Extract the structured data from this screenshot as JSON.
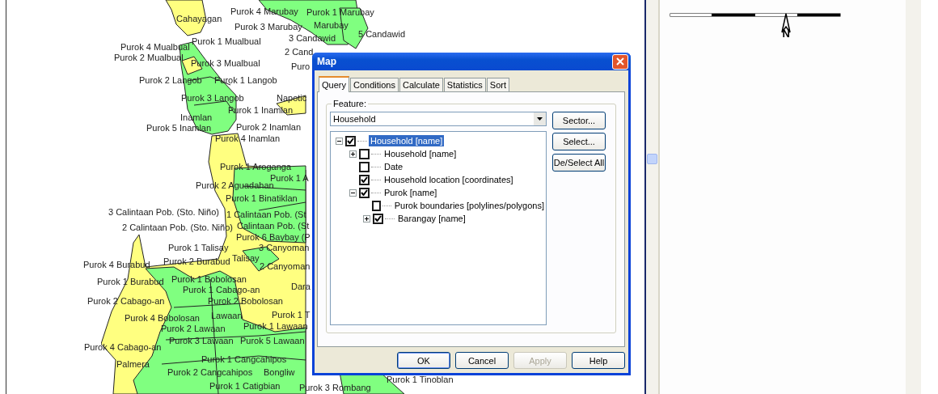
{
  "map": {
    "labels": [
      {
        "text": "Cahayagan"
      },
      {
        "text": "Purok 4 Marubay"
      },
      {
        "text": "Purok 1 Marubay"
      },
      {
        "text": "Purok 3 Marubay"
      },
      {
        "text": "Marubay"
      },
      {
        "text": "3 Candawid"
      },
      {
        "text": "5 Candawid"
      },
      {
        "text": "Purok 1 Mualbual"
      },
      {
        "text": "Purok 4 Mualbual"
      },
      {
        "text": "2 Cand"
      },
      {
        "text": "Purok 2 Mualbual"
      },
      {
        "text": "Puro"
      },
      {
        "text": "Purok 3 Mualbual"
      },
      {
        "text": "Purok 2 Langob"
      },
      {
        "text": "Purok 1 Langob"
      },
      {
        "text": "Purok 3 Langob"
      },
      {
        "text": "Napotic"
      },
      {
        "text": "Purok 1 Inamlan"
      },
      {
        "text": "Inamlan"
      },
      {
        "text": "Purok 5 Inamlan"
      },
      {
        "text": "Purok 2 Inamlan"
      },
      {
        "text": "Purok 4 Inamlan"
      },
      {
        "text": "Purok 1 Aroganga"
      },
      {
        "text": "Purok 1 A"
      },
      {
        "text": "Purok 2 Aguadahan"
      },
      {
        "text": "Purok 1 Binatiklan"
      },
      {
        "text": "3 Calintaan Pob. (Sto. Niño)"
      },
      {
        "text": "1 Calintaan Pob. (St"
      },
      {
        "text": "2 Calintaan Pob. (Sto. Niño)"
      },
      {
        "text": "Calintaan Pob. (St"
      },
      {
        "text": "Purok 6 Baybay (P"
      },
      {
        "text": "Purok 1 Talisay"
      },
      {
        "text": "3 Canyoman"
      },
      {
        "text": "Purok 4 Burabud"
      },
      {
        "text": "Purok 2 Burabud"
      },
      {
        "text": "Talisay"
      },
      {
        "text": "2 Canyoman"
      },
      {
        "text": "Purok 1 Burabud"
      },
      {
        "text": "Purok 1 Bobolosan"
      },
      {
        "text": "Dara"
      },
      {
        "text": "Purok 1 Cabago-an"
      },
      {
        "text": "Purok 2 Cabago-an"
      },
      {
        "text": "Purok 2 Bobolosan"
      },
      {
        "text": "Purok 4 Bobolosan"
      },
      {
        "text": "Lawaan"
      },
      {
        "text": "Purok 1 T"
      },
      {
        "text": "Purok 2 Lawaan"
      },
      {
        "text": "Purok 1 Lawaan"
      },
      {
        "text": "Purok 3 Lawaan"
      },
      {
        "text": "Purok 5 Lawaan"
      },
      {
        "text": "Purok 4 Cabago-an"
      },
      {
        "text": "Palmera"
      },
      {
        "text": "Purok 1 Cangcahipos"
      },
      {
        "text": "Purok 2 Cangcahipos"
      },
      {
        "text": "Bongliw"
      },
      {
        "text": "Purok 1 Catigbian"
      },
      {
        "text": "Purok 1 Tinoblan"
      },
      {
        "text": "Purok 3 Rombang"
      }
    ]
  },
  "legend": {
    "north_arrow": {
      "label": "N"
    }
  },
  "dialog": {
    "title": "Map",
    "tabs": [
      {
        "label": "Query",
        "selected": true
      },
      {
        "label": "Conditions",
        "selected": false
      },
      {
        "label": "Calculate",
        "selected": false
      },
      {
        "label": "Statistics",
        "selected": false
      },
      {
        "label": "Sort",
        "selected": false
      }
    ],
    "feature_group": {
      "label": "Feature:",
      "select": {
        "value": "Household"
      },
      "tree": [
        {
          "label": "Household [name]",
          "checked": true,
          "expanded": true,
          "selected": true,
          "children": [
            {
              "label": "Household [name]",
              "checked": false,
              "expanded": false,
              "selected": false
            },
            {
              "label": "Date",
              "checked": false,
              "selected": false
            },
            {
              "label": "Household location [coordinates]",
              "checked": true,
              "selected": false
            },
            {
              "label": "Purok [name]",
              "checked": true,
              "expanded": true,
              "selected": false,
              "children": [
                {
                  "label": "Purok boundaries [polylines/polygons]",
                  "checked": false,
                  "selected": false
                },
                {
                  "label": "Barangay [name]",
                  "checked": true,
                  "expanded": false,
                  "selected": false
                }
              ]
            }
          ]
        }
      ],
      "side_buttons": [
        {
          "label": "Sector..."
        },
        {
          "label": "Select..."
        },
        {
          "label": "De/Select All"
        }
      ]
    },
    "buttons": [
      {
        "label": "OK",
        "disabled": false,
        "default": true
      },
      {
        "label": "Cancel",
        "disabled": false,
        "default": false
      },
      {
        "label": "Apply",
        "disabled": true,
        "default": false
      },
      {
        "label": "Help",
        "disabled": false,
        "default": false
      }
    ]
  }
}
